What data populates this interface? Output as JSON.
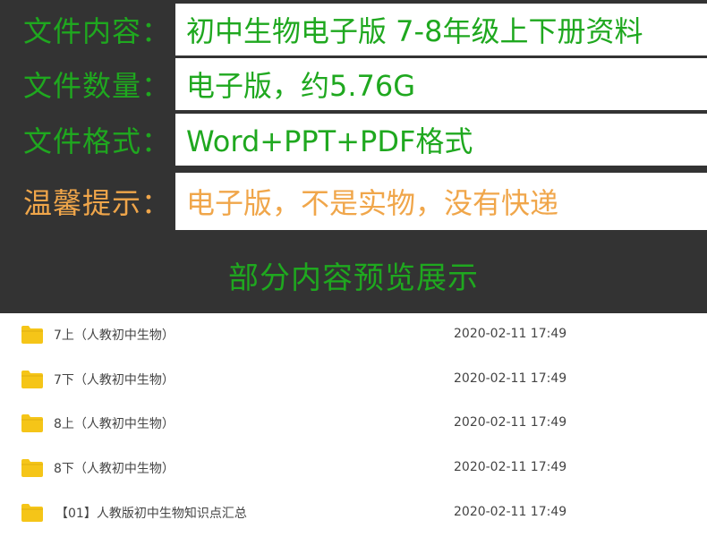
{
  "info": {
    "rows": [
      {
        "label": "文件内容：",
        "value": "初中生物电子版 7-8年级上下册资料"
      },
      {
        "label": "文件数量：",
        "value": "电子版，约5.76G"
      },
      {
        "label": "文件格式：",
        "value": "Word+PPT+PDF格式"
      },
      {
        "label": "温馨提示：",
        "value": "电子版，不是实物，没有快递"
      }
    ],
    "preview_title": "部分内容预览展示"
  },
  "files": [
    {
      "name": "7上（人教初中生物）",
      "date": "2020-02-11 17:49",
      "icon": "folder-icon"
    },
    {
      "name": "7下（人教初中生物）",
      "date": "2020-02-11 17:49",
      "icon": "folder-icon"
    },
    {
      "name": "8上（人教初中生物）",
      "date": "2020-02-11 17:49",
      "icon": "folder-icon"
    },
    {
      "name": "8下（人教初中生物）",
      "date": "2020-02-11 17:49",
      "icon": "folder-icon"
    },
    {
      "name": "【01】人教版初中生物知识点汇总",
      "date": "2020-02-11 17:49",
      "icon": "folder-icon"
    }
  ],
  "colors": {
    "panel_background": "#333333",
    "green_text": "#1fa81f",
    "orange_text": "#f0a64a",
    "folder": "#f5c518"
  }
}
